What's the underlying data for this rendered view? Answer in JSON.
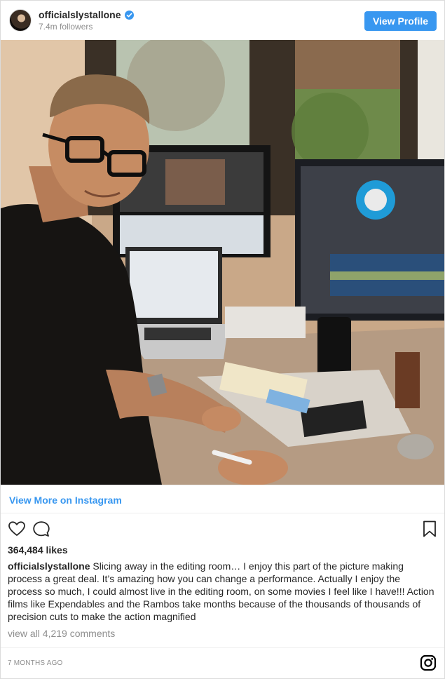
{
  "header": {
    "username": "officialslystallone",
    "followers": "7.4m followers",
    "view_profile_label": "View Profile"
  },
  "post": {
    "view_more_label": "View More on Instagram",
    "likes": "364,484 likes",
    "caption_user": "officialslystallone",
    "caption_text": "Slicing away in the editing room… I enjoy this part of the picture making process a great deal. It’s amazing how you can change a performance. Actually I enjoy the process so much, I could almost live in the editing room, on some movies I feel like I have!!! Action films like Expendables and the Rambos take months because of the thousands of thousands of precision cuts to make the action magnified",
    "comments_label": "view all 4,219 comments",
    "timestamp": "7 MONTHS AGO"
  },
  "icons": {
    "like": "heart-icon",
    "comment": "comment-icon",
    "save": "bookmark-icon",
    "brand": "instagram-icon",
    "verified": "verified-badge-icon"
  },
  "colors": {
    "accent": "#3897f0",
    "text": "#262626",
    "muted": "#8e8e8e"
  }
}
